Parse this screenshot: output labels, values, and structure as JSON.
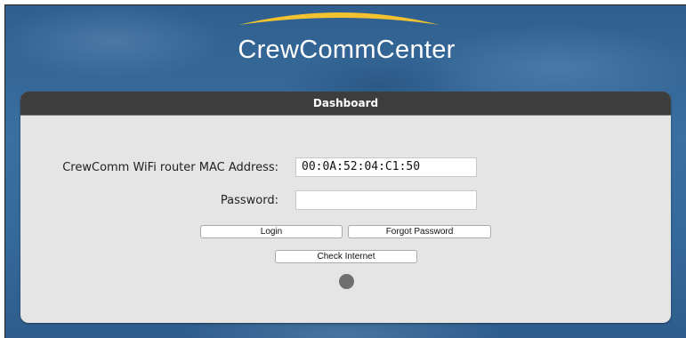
{
  "brand": {
    "name": "CrewCommCenter",
    "arc_color": "#f2c230"
  },
  "panel": {
    "title": "Dashboard"
  },
  "form": {
    "mac_label": "CrewComm WiFi router MAC Address:",
    "mac_value": "00:0A:52:04:C1:50",
    "password_label": "Password:",
    "password_value": ""
  },
  "buttons": {
    "login": "Login",
    "forgot_password": "Forgot Password",
    "check_internet": "Check Internet"
  },
  "status": {
    "indicator_color": "#6e6e6e"
  }
}
